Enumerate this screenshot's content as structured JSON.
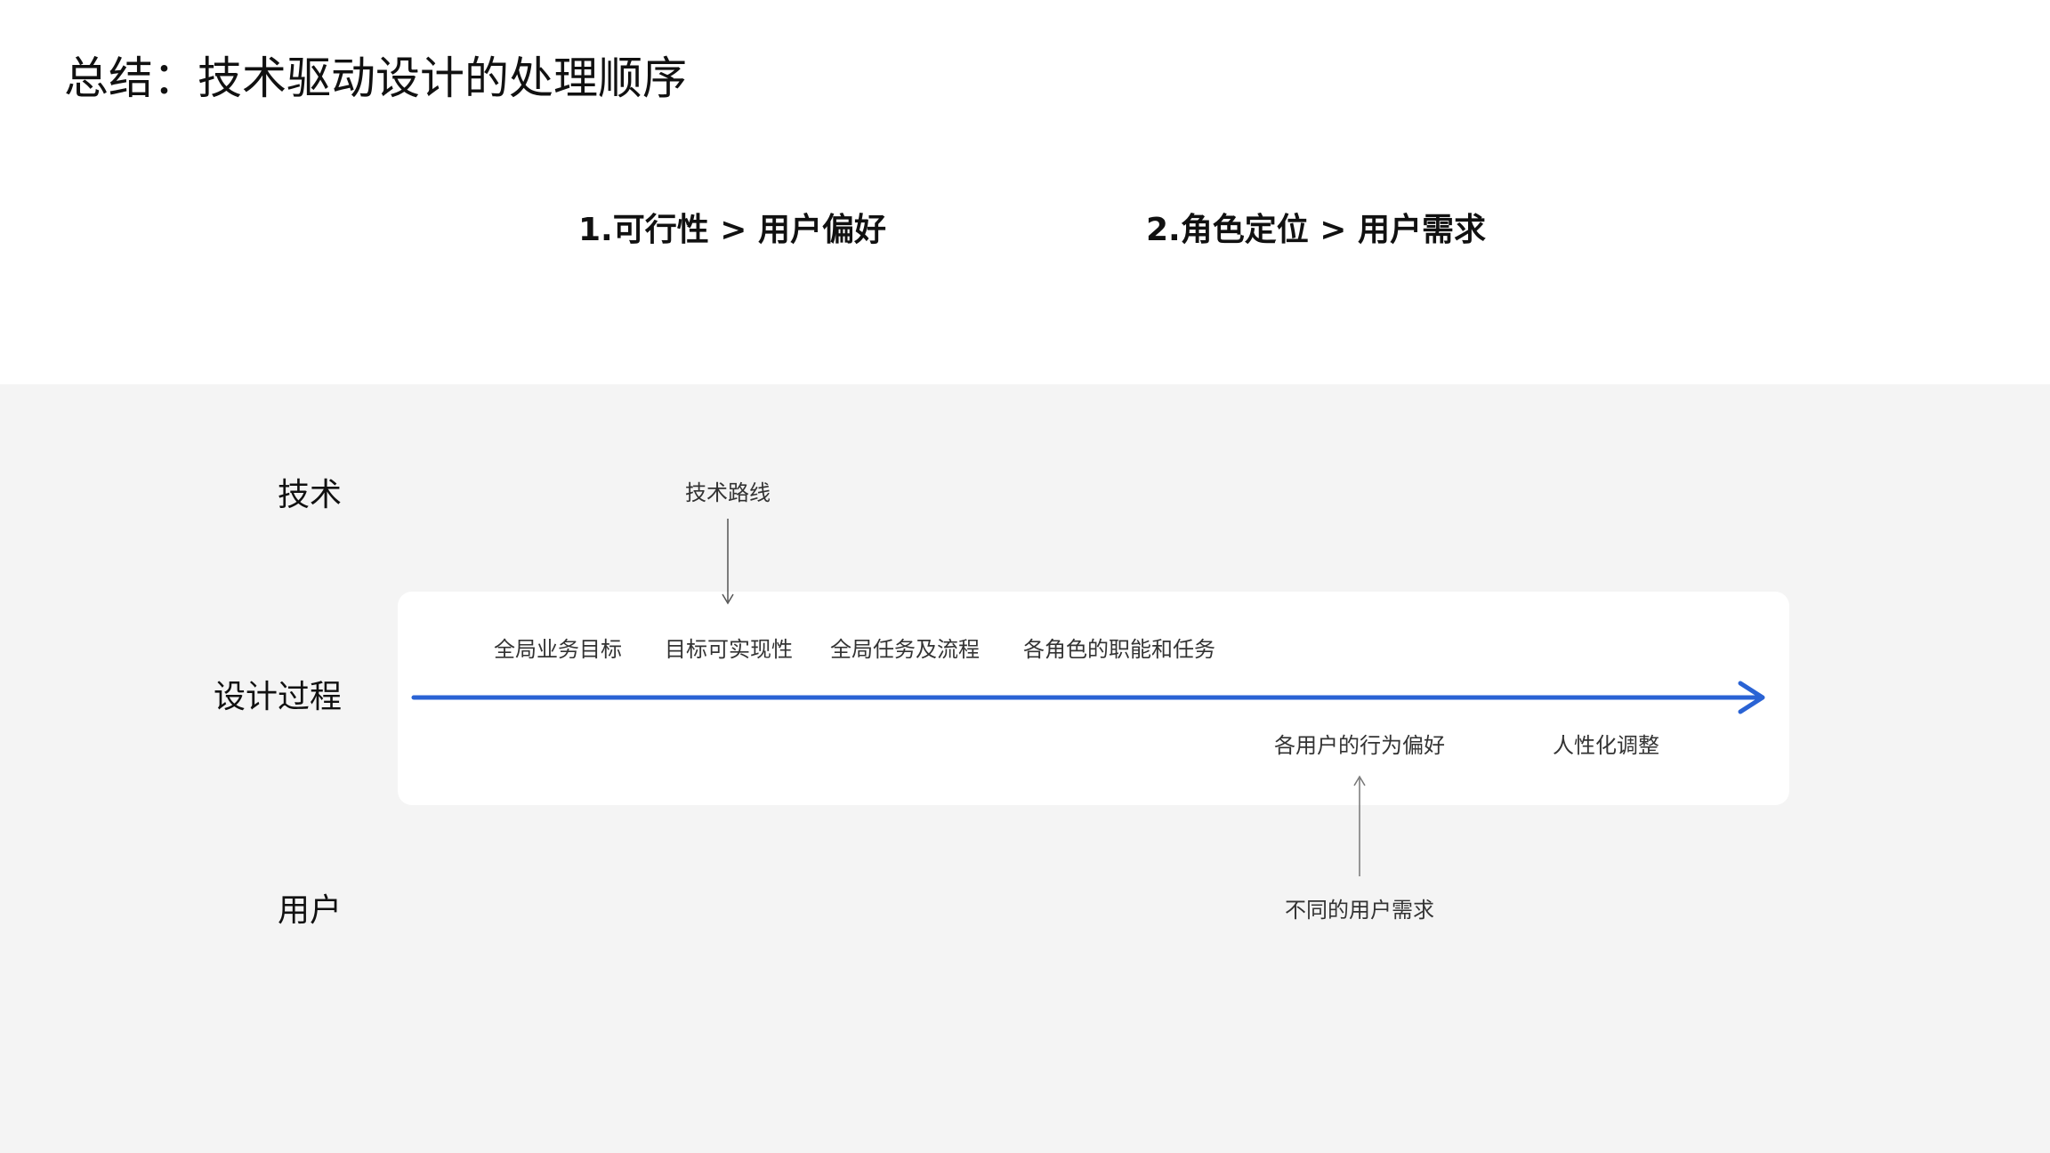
{
  "title": "总结：技术驱动设计的处理顺序",
  "principles": [
    "1.可行性 > 用户偏好",
    "2.角色定位 > 用户需求"
  ],
  "rows": {
    "tech": "技术",
    "process": "设计过程",
    "user": "用户"
  },
  "inputs": {
    "tech": "技术路线",
    "user": "不同的用户需求"
  },
  "steps": [
    "全局业务目标",
    "目标可实现性",
    "全局任务及流程",
    "各角色的职能和任务",
    "各用户的行为偏好",
    "人性化调整"
  ],
  "colors": {
    "timeline": "#2a63d4",
    "band": "#f4f4f4",
    "card": "#ffffff",
    "connector": "#555555"
  }
}
